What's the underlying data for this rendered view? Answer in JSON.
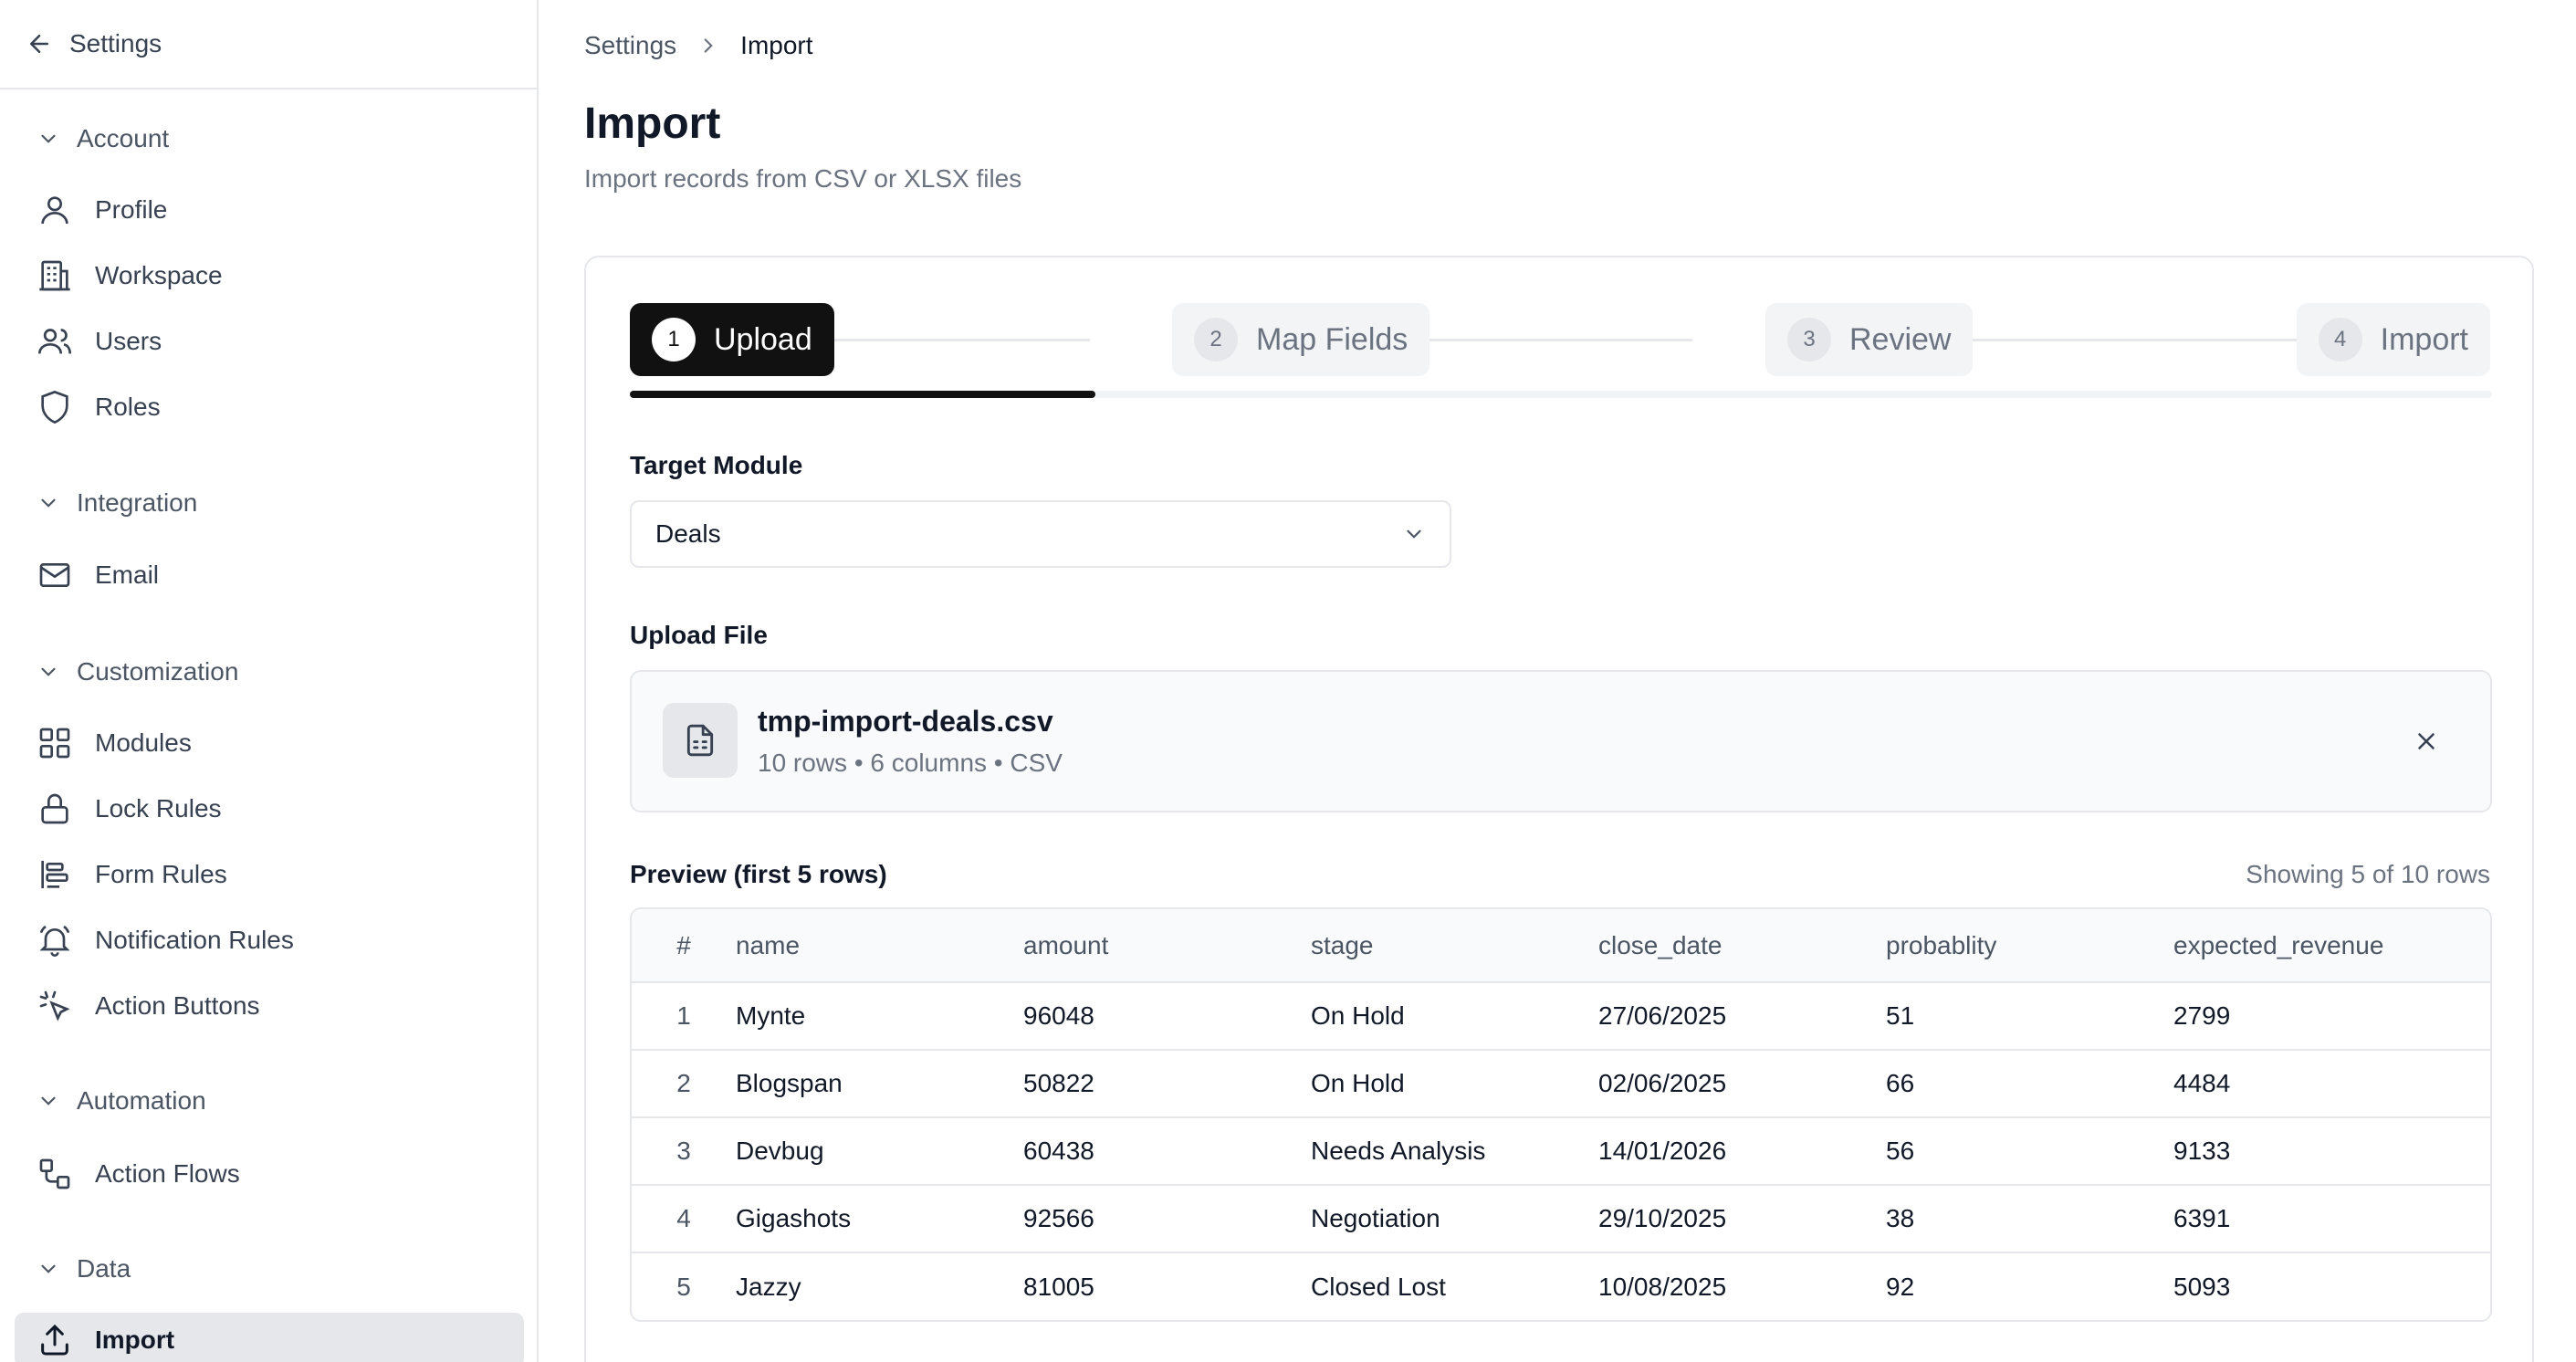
{
  "sidebar": {
    "back_label": "Settings",
    "groups": [
      {
        "label": "Account",
        "items": [
          {
            "label": "Profile",
            "icon": "user-icon"
          },
          {
            "label": "Workspace",
            "icon": "building-icon"
          },
          {
            "label": "Users",
            "icon": "users-icon"
          },
          {
            "label": "Roles",
            "icon": "shield-icon"
          }
        ]
      },
      {
        "label": "Integration",
        "items": [
          {
            "label": "Email",
            "icon": "mail-icon"
          }
        ]
      },
      {
        "label": "Customization",
        "items": [
          {
            "label": "Modules",
            "icon": "grid-icon"
          },
          {
            "label": "Lock Rules",
            "icon": "lock-icon"
          },
          {
            "label": "Form Rules",
            "icon": "align-left-icon"
          },
          {
            "label": "Notification Rules",
            "icon": "bell-icon"
          },
          {
            "label": "Action Buttons",
            "icon": "pointer-click-icon"
          }
        ]
      },
      {
        "label": "Automation",
        "items": [
          {
            "label": "Action Flows",
            "icon": "workflow-icon"
          }
        ]
      },
      {
        "label": "Data",
        "items": [
          {
            "label": "Import",
            "icon": "upload-icon",
            "active": true
          }
        ]
      }
    ]
  },
  "breadcrumb": {
    "parent": "Settings",
    "current": "Import"
  },
  "page": {
    "title": "Import",
    "subtitle": "Import records from CSV or XLSX files"
  },
  "stepper": {
    "progress_fraction": 0.25,
    "steps": [
      {
        "num": "1",
        "label": "Upload",
        "active": true
      },
      {
        "num": "2",
        "label": "Map Fields",
        "active": false
      },
      {
        "num": "3",
        "label": "Review",
        "active": false
      },
      {
        "num": "4",
        "label": "Import",
        "active": false
      }
    ]
  },
  "target_module": {
    "label": "Target Module",
    "value": "Deals"
  },
  "upload": {
    "label": "Upload File",
    "file_name": "tmp-import-deals.csv",
    "file_meta": "10 rows • 6 columns • CSV"
  },
  "preview": {
    "title": "Preview (first 5 rows)",
    "count_text": "Showing 5 of 10 rows",
    "columns": [
      "#",
      "name",
      "amount",
      "stage",
      "close_date",
      "probablity",
      "expected_revenue"
    ],
    "rows": [
      [
        "1",
        "Mynte",
        "96048",
        "On Hold",
        "27/06/2025",
        "51",
        "2799"
      ],
      [
        "2",
        "Blogspan",
        "50822",
        "On Hold",
        "02/06/2025",
        "66",
        "4484"
      ],
      [
        "3",
        "Devbug",
        "60438",
        "Needs Analysis",
        "14/01/2026",
        "56",
        "9133"
      ],
      [
        "4",
        "Gigashots",
        "92566",
        "Negotiation",
        "29/10/2025",
        "38",
        "6391"
      ],
      [
        "5",
        "Jazzy",
        "81005",
        "Closed Lost",
        "10/08/2025",
        "92",
        "5093"
      ]
    ]
  }
}
